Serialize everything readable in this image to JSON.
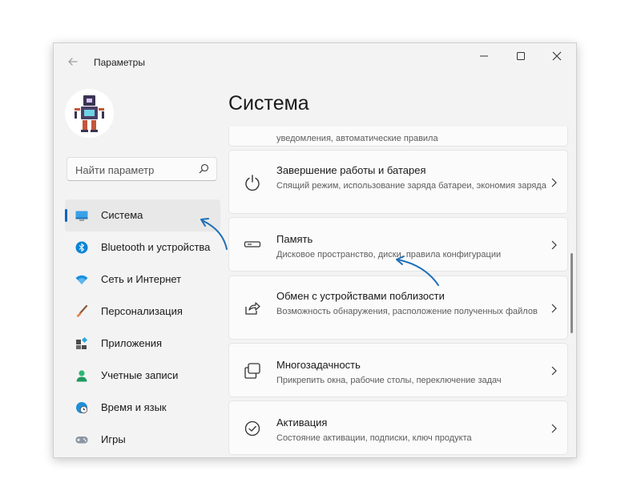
{
  "window": {
    "title": "Параметры",
    "accent_color": "#0067c0",
    "buttons": [
      "back",
      "minimize",
      "maximize",
      "close"
    ]
  },
  "sidebar": {
    "search": {
      "placeholder": "Найти параметр",
      "icon": "search-icon"
    },
    "items": [
      {
        "label": "Система",
        "icon": "monitor-icon",
        "active": true
      },
      {
        "label": "Bluetooth и устройства",
        "icon": "bluetooth-icon"
      },
      {
        "label": "Сеть и Интернет",
        "icon": "wifi-icon"
      },
      {
        "label": "Персонализация",
        "icon": "brush-icon"
      },
      {
        "label": "Приложения",
        "icon": "apps-icon"
      },
      {
        "label": "Учетные записи",
        "icon": "user-icon"
      },
      {
        "label": "Время и язык",
        "icon": "globe-clock-icon"
      },
      {
        "label": "Игры",
        "icon": "gamepad-icon"
      }
    ]
  },
  "main": {
    "title": "Система",
    "cut_text": "уведомления, автоматические правила",
    "cards": [
      {
        "title": "Завершение работы и батарея",
        "subtitle": "Спящий режим, использование заряда батареи, экономия заряда",
        "icon": "power-icon"
      },
      {
        "title": "Память",
        "subtitle": "Дисковое пространство, диски, правила конфигурации",
        "icon": "storage-icon"
      },
      {
        "title": "Обмен с устройствами поблизости",
        "subtitle": "Возможность обнаружения, расположение полученных файлов",
        "icon": "share-icon"
      },
      {
        "title": "Многозадачность",
        "subtitle": "Прикрепить окна, рабочие столы, переключение задач",
        "icon": "multitask-icon"
      },
      {
        "title": "Активация",
        "subtitle": "Состояние активации, подписки, ключ продукта",
        "icon": "check-circle-icon"
      }
    ]
  }
}
